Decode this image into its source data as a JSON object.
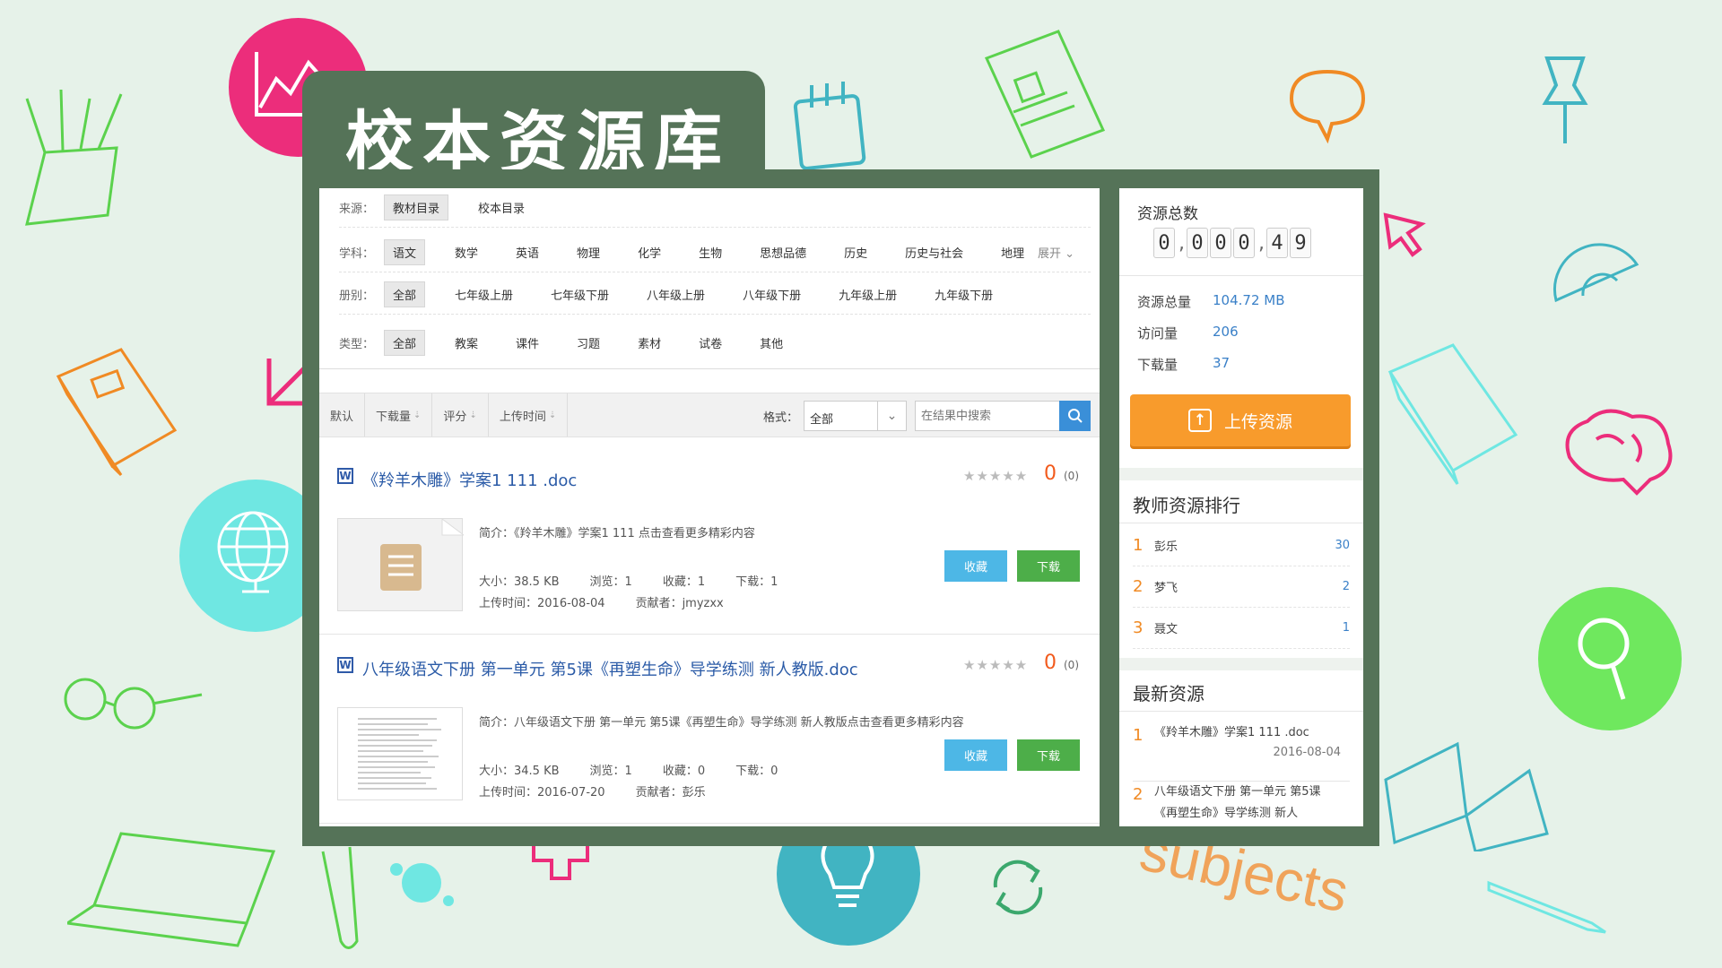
{
  "app": {
    "title": "校本资源库",
    "deco_word": "subjects"
  },
  "filters": {
    "source": {
      "label": "来源：",
      "options": [
        "教材目录",
        "校本目录"
      ],
      "selected": 0
    },
    "subject": {
      "label": "学科：",
      "options": [
        "语文",
        "数学",
        "英语",
        "物理",
        "化学",
        "生物",
        "思想品德",
        "历史",
        "历史与社会",
        "地理"
      ],
      "selected": 0,
      "expand": "展开 ⌄"
    },
    "volume": {
      "label": "册别：",
      "options": [
        "全部",
        "七年级上册",
        "七年级下册",
        "八年级上册",
        "八年级下册",
        "九年级上册",
        "九年级下册"
      ],
      "selected": 0
    },
    "type": {
      "label": "类型：",
      "options": [
        "全部",
        "教案",
        "课件",
        "习题",
        "素材",
        "试卷",
        "其他"
      ],
      "selected": 0
    }
  },
  "sortbar": {
    "items": [
      "默认",
      "下载量",
      "评分",
      "上传时间"
    ],
    "format_label": "格式：",
    "format_value": "全部",
    "search_placeholder": "在结果中搜索"
  },
  "resources": [
    {
      "title": "《羚羊木雕》学案1 111 .doc",
      "score": "0",
      "count": "(0)",
      "desc": "简介：《羚羊木雕》学案1 111 点击查看更多精彩内容",
      "size": "大小：38.5 KB",
      "views": "浏览：1",
      "favs": "收藏：1",
      "downloads": "下载：1",
      "upload_time": "上传时间：2016-08-04",
      "contributor": "贡献者：jmyzxx",
      "fav_label": "收藏",
      "dl_label": "下载"
    },
    {
      "title": "八年级语文下册 第一单元 第5课《再塑生命》导学练测 新人教版.doc",
      "score": "0",
      "count": "(0)",
      "desc": "简介：八年级语文下册 第一单元 第5课《再塑生命》导学练测 新人教版点击查看更多精彩内容",
      "size": "大小：34.5 KB",
      "views": "浏览：1",
      "favs": "收藏：0",
      "downloads": "下载：0",
      "upload_time": "上传时间：2016-07-20",
      "contributor": "贡献者：彭乐",
      "fav_label": "收藏",
      "dl_label": "下载"
    }
  ],
  "sidebar": {
    "total_title": "资源总数",
    "digits": [
      "0",
      "0",
      "0",
      "0",
      "4",
      "9"
    ],
    "stats": [
      {
        "k": "资源总量",
        "v": "104.72 MB"
      },
      {
        "k": "访问量",
        "v": "206"
      },
      {
        "k": "下载量",
        "v": "37"
      }
    ],
    "upload_label": "上传资源",
    "ranking_title": "教师资源排行",
    "ranking": [
      {
        "n": "1",
        "name": "彭乐",
        "v": "30"
      },
      {
        "n": "2",
        "name": "梦飞",
        "v": "2"
      },
      {
        "n": "3",
        "name": "聂文",
        "v": "1"
      }
    ],
    "latest_title": "最新资源",
    "latest": [
      {
        "n": "1",
        "t": "《羚羊木雕》学案1 111 .doc",
        "d": "2016-08-04"
      },
      {
        "n": "2",
        "t": "八年级语文下册 第一单元 第5课《再塑生命》导学练测 新人",
        "d": ""
      }
    ]
  },
  "colors": {
    "board": "#557358",
    "accent_blue": "#3a8fd8",
    "upload_orange": "#f89b2c",
    "download_green": "#4dae49",
    "fav_blue": "#4db7e6"
  }
}
